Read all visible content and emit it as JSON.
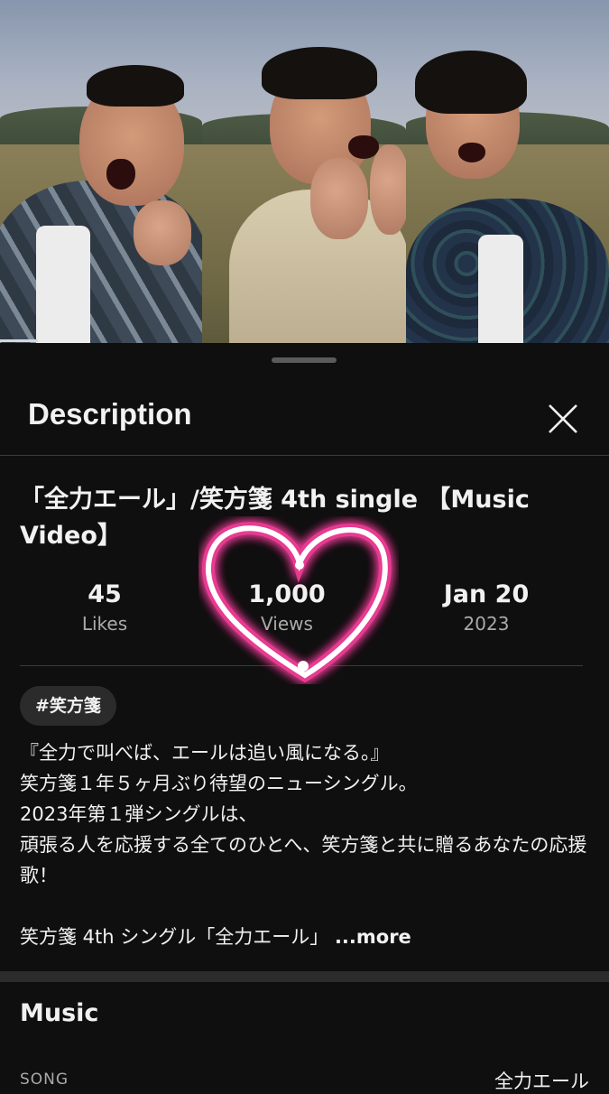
{
  "sheet": {
    "title": "Description",
    "close_icon": "close-icon"
  },
  "video": {
    "title": "「全力エール」/笑方箋 4th single 【Music Video】"
  },
  "stats": {
    "likes_value": "45",
    "likes_label": "Likes",
    "views_value": "1,000",
    "views_label": "Views",
    "date_value": "Jan 20",
    "date_year": "2023"
  },
  "overlay": {
    "heart_icon": "neon-heart-icon",
    "color": "#ff3fa0"
  },
  "hashtag": "#笑方箋",
  "description": {
    "lines": [
      "『全力で叫べば、エールは追い風になる。』",
      "笑方箋１年５ヶ月ぶり待望のニューシングル。",
      "2023年第１弾シングルは、",
      "頑張る人を応援する全てのひとへ、笑方箋と共に贈るあなたの応援歌！"
    ],
    "teaser": "笑方箋 4th シングル「全力エール」",
    "more_label": "...more"
  },
  "music": {
    "title": "Music",
    "song_label": "SONG",
    "song_value": "全力エール"
  }
}
